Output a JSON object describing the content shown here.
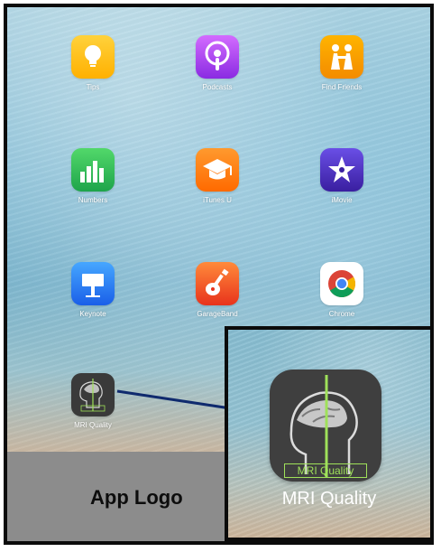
{
  "home_screen": {
    "apps": [
      {
        "name": "Tips",
        "icon": "tips-lightbulb-icon"
      },
      {
        "name": "Podcasts",
        "icon": "podcasts-icon"
      },
      {
        "name": "Find Friends",
        "icon": "find-friends-icon"
      },
      {
        "name": "Numbers",
        "icon": "numbers-chart-icon"
      },
      {
        "name": "iTunes U",
        "icon": "itunes-u-mortarboard-icon"
      },
      {
        "name": "iMovie",
        "icon": "imovie-star-icon"
      },
      {
        "name": "Keynote",
        "icon": "keynote-podium-icon"
      },
      {
        "name": "GarageBand",
        "icon": "garageband-guitar-icon"
      },
      {
        "name": "Chrome",
        "icon": "chrome-icon"
      },
      {
        "name": "MRI Quality",
        "icon": "mri-quality-head-icon"
      }
    ]
  },
  "zoom": {
    "label": "MRI Quality",
    "badge": "MRI Quality"
  },
  "caption": "App Logo",
  "colors": {
    "frame_border": "#0b0b0b",
    "bottom_panel": "#8c8c8c",
    "arrow": "#0f2a6e",
    "mri_green": "#9fe15a"
  }
}
